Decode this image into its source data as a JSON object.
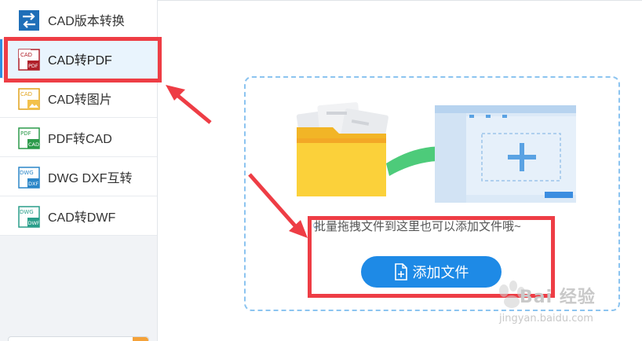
{
  "sidebar": {
    "items": [
      {
        "label": "CAD版本转换",
        "icon": "cad-version-convert-icon",
        "icon_color": "#1f6fb8"
      },
      {
        "label": "CAD转PDF",
        "icon": "cad-to-pdf-icon",
        "icon_color": "#b0202a"
      },
      {
        "label": "CAD转图片",
        "icon": "cad-to-image-icon",
        "icon_color": "#e1a21a"
      },
      {
        "label": "PDF转CAD",
        "icon": "pdf-to-cad-icon",
        "icon_color": "#2c9a4a"
      },
      {
        "label": "DWG DXF互转",
        "icon": "dwg-dxf-convert-icon",
        "icon_color": "#2b86c8"
      },
      {
        "label": "CAD转DWF",
        "icon": "cad-to-dwf-icon",
        "icon_color": "#2a9e8a"
      }
    ],
    "active_index": 1
  },
  "main": {
    "hint_text": "批量拖拽文件到这里也可以添加文件哦~",
    "add_button_label": "添加文件"
  },
  "watermark": {
    "main": "Bai 经验",
    "sub": "jingyan.baidu.com"
  },
  "colors": {
    "accent": "#1e8ae6",
    "annotation_red": "#ee3d45",
    "dropzone_border": "#8cc4f0"
  }
}
